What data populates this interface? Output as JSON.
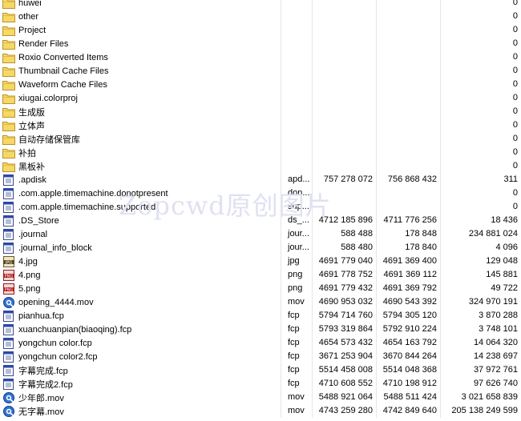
{
  "watermark": "Zopcwd原创图片",
  "rows": [
    {
      "name": "huwei",
      "icon": "folder-icon",
      "ext": "",
      "c1": "",
      "c2": "",
      "c3": "0"
    },
    {
      "name": "other",
      "icon": "folder-icon",
      "ext": "",
      "c1": "",
      "c2": "",
      "c3": "0"
    },
    {
      "name": "Project",
      "icon": "folder-icon",
      "ext": "",
      "c1": "",
      "c2": "",
      "c3": "0"
    },
    {
      "name": "Render Files",
      "icon": "folder-icon",
      "ext": "",
      "c1": "",
      "c2": "",
      "c3": "0"
    },
    {
      "name": "Roxio Converted Items",
      "icon": "folder-icon",
      "ext": "",
      "c1": "",
      "c2": "",
      "c3": "0"
    },
    {
      "name": "Thumbnail Cache Files",
      "icon": "folder-icon",
      "ext": "",
      "c1": "",
      "c2": "",
      "c3": "0"
    },
    {
      "name": "Waveform Cache Files",
      "icon": "folder-icon",
      "ext": "",
      "c1": "",
      "c2": "",
      "c3": "0"
    },
    {
      "name": "xiugai.colorproj",
      "icon": "folder-icon",
      "ext": "",
      "c1": "",
      "c2": "",
      "c3": "0"
    },
    {
      "name": "生成版",
      "icon": "folder-icon",
      "ext": "",
      "c1": "",
      "c2": "",
      "c3": "0"
    },
    {
      "name": "立体声",
      "icon": "folder-icon",
      "ext": "",
      "c1": "",
      "c2": "",
      "c3": "0"
    },
    {
      "name": "自动存储保管库",
      "icon": "folder-icon",
      "ext": "",
      "c1": "",
      "c2": "",
      "c3": "0"
    },
    {
      "name": "补拍",
      "icon": "folder-icon",
      "ext": "",
      "c1": "",
      "c2": "",
      "c3": "0"
    },
    {
      "name": "黑板补",
      "icon": "folder-icon",
      "ext": "",
      "c1": "",
      "c2": "",
      "c3": "0"
    },
    {
      "name": ".apdisk",
      "icon": "file-icon",
      "ext": "apd...",
      "c1": "757 278 072",
      "c2": "756 868 432",
      "c3": "311"
    },
    {
      "name": ".com.apple.timemachine.donotpresent",
      "icon": "file-icon",
      "ext": "don...",
      "c1": "",
      "c2": "",
      "c3": "0"
    },
    {
      "name": ".com.apple.timemachine.supported",
      "icon": "file-icon",
      "ext": "sup...",
      "c1": "",
      "c2": "",
      "c3": "0"
    },
    {
      "name": ".DS_Store",
      "icon": "file-icon",
      "ext": "ds_...",
      "c1": "4712 185 896",
      "c2": "4711 776 256",
      "c3": "18 436"
    },
    {
      "name": ".journal",
      "icon": "file-icon",
      "ext": "jour...",
      "c1": "588 488",
      "c2": "178 848",
      "c3": "234 881 024"
    },
    {
      "name": ".journal_info_block",
      "icon": "file-icon",
      "ext": "jour...",
      "c1": "588 480",
      "c2": "178 840",
      "c3": "4 096"
    },
    {
      "name": "4.jpg",
      "icon": "jpg-icon",
      "ext": "jpg",
      "c1": "4691 779 040",
      "c2": "4691 369 400",
      "c3": "129 048"
    },
    {
      "name": "4.png",
      "icon": "png-icon",
      "ext": "png",
      "c1": "4691 778 752",
      "c2": "4691 369 112",
      "c3": "145 881"
    },
    {
      "name": "5.png",
      "icon": "png-icon",
      "ext": "png",
      "c1": "4691 779 432",
      "c2": "4691 369 792",
      "c3": "49 722"
    },
    {
      "name": "opening_4444.mov",
      "icon": "quicktime-icon",
      "ext": "mov",
      "c1": "4690 953 032",
      "c2": "4690 543 392",
      "c3": "324 970 191"
    },
    {
      "name": "pianhua.fcp",
      "icon": "file-icon",
      "ext": "fcp",
      "c1": "5794 714 760",
      "c2": "5794 305 120",
      "c3": "3 870 288"
    },
    {
      "name": "xuanchuanpian(biaoqing).fcp",
      "icon": "file-icon",
      "ext": "fcp",
      "c1": "5793 319 864",
      "c2": "5792 910 224",
      "c3": "3 748 101"
    },
    {
      "name": "yongchun color.fcp",
      "icon": "file-icon",
      "ext": "fcp",
      "c1": "4654 573 432",
      "c2": "4654 163 792",
      "c3": "14 064 320"
    },
    {
      "name": "yongchun color2.fcp",
      "icon": "file-icon",
      "ext": "fcp",
      "c1": "3671 253 904",
      "c2": "3670 844 264",
      "c3": "14 238 697"
    },
    {
      "name": "字幕完成.fcp",
      "icon": "file-icon",
      "ext": "fcp",
      "c1": "5514 458 008",
      "c2": "5514 048 368",
      "c3": "37 972 761"
    },
    {
      "name": "字幕完成2.fcp",
      "icon": "file-icon",
      "ext": "fcp",
      "c1": "4710 608 552",
      "c2": "4710 198 912",
      "c3": "97 626 740"
    },
    {
      "name": "少年郎.mov",
      "icon": "quicktime-icon",
      "ext": "mov",
      "c1": "5488 921 064",
      "c2": "5488 511 424",
      "c3": "3 021 658 839"
    },
    {
      "name": "无字幕.mov",
      "icon": "quicktime-icon",
      "ext": "mov",
      "c1": "4743 259 280",
      "c2": "4742 849 640",
      "c3": "205 138 249 599"
    }
  ]
}
